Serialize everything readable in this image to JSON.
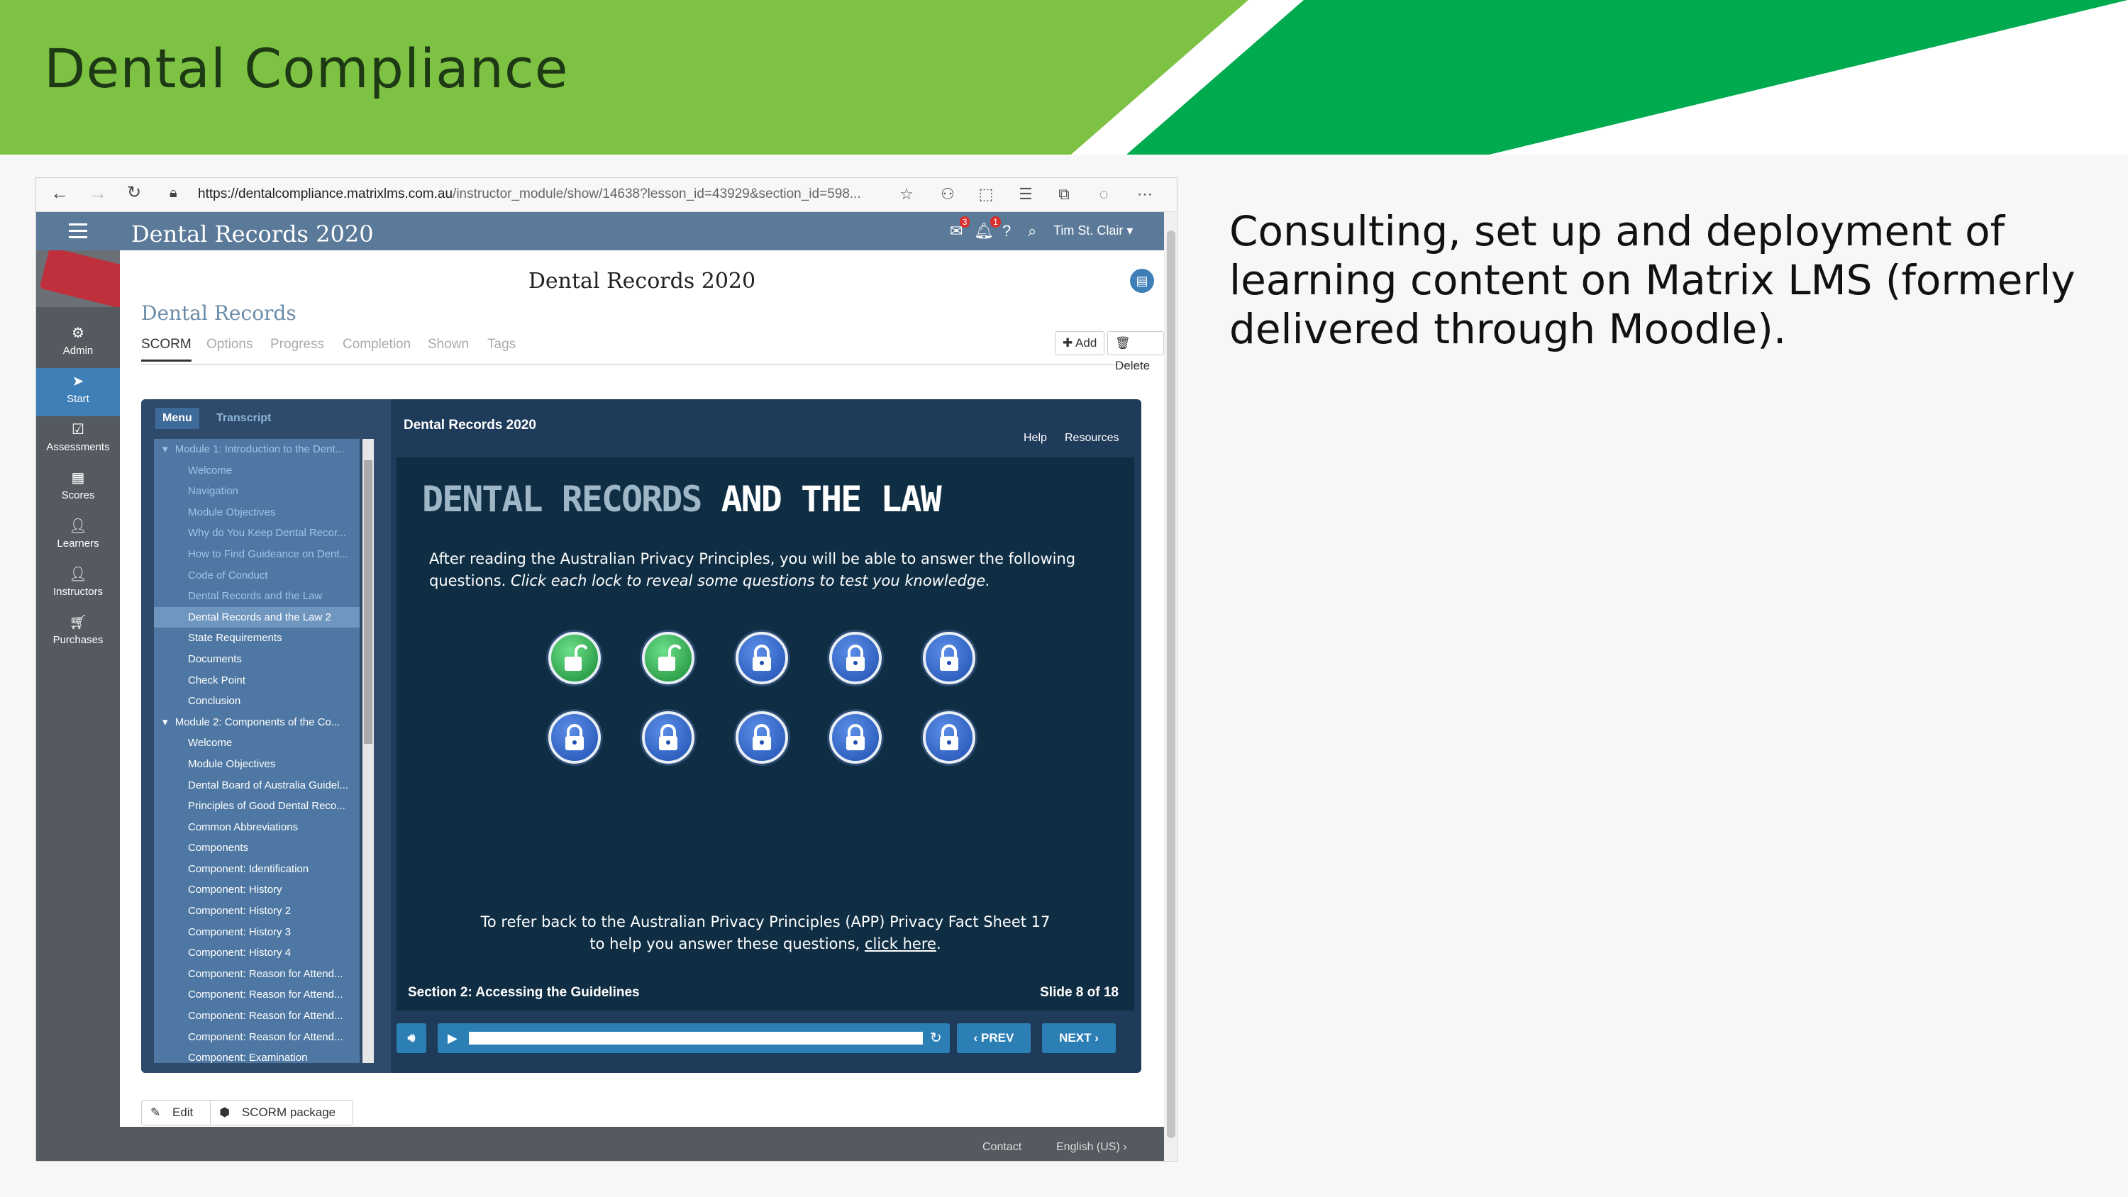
{
  "slide": {
    "title": "Dental Compliance",
    "description": "Consulting, set up and deployment of learning content on Matrix LMS (formerly delivered through Moodle).",
    "colors": {
      "light_green": "#7dc242",
      "dark_green": "#00aa4f"
    }
  },
  "browser": {
    "url_host": "https://dentalcompliance.matrixlms.com.au",
    "url_path": "/instructor_module/show/14638?lesson_id=43929&section_id=598..."
  },
  "app": {
    "title": "Dental Records 2020",
    "notifications_count": "3",
    "alerts_count": "1",
    "user": "Tim St. Clair"
  },
  "sidebar": {
    "items": [
      {
        "label": "Admin",
        "icon": "gear-icon"
      },
      {
        "label": "Start",
        "icon": "send-icon"
      },
      {
        "label": "Assessments",
        "icon": "checkbox-icon"
      },
      {
        "label": "Scores",
        "icon": "grid-icon"
      },
      {
        "label": "Learners",
        "icon": "user-icon"
      },
      {
        "label": "Instructors",
        "icon": "user-icon"
      },
      {
        "label": "Purchases",
        "icon": "cart-icon"
      }
    ]
  },
  "page": {
    "heading": "Dental Records 2020",
    "section": "Dental Records",
    "tabs": [
      "SCORM",
      "Options",
      "Progress",
      "Completion",
      "Shown",
      "Tags"
    ],
    "add_label": "Add",
    "delete_label": "Delete",
    "edit_label": "Edit",
    "package_label": "SCORM package",
    "footer_contact": "Contact",
    "footer_language": "English (US)"
  },
  "player": {
    "menu_tab": "Menu",
    "transcript_tab": "Transcript",
    "title": "Dental Records 2020",
    "help": "Help",
    "resources": "Resources",
    "menu_items": [
      {
        "label": "Module 1: Introduction to the Dent...",
        "kind": "module-dim"
      },
      {
        "label": "Welcome",
        "kind": "dim"
      },
      {
        "label": "Navigation",
        "kind": "dim"
      },
      {
        "label": "Module Objectives",
        "kind": "dim"
      },
      {
        "label": "Why do You Keep Dental Recor...",
        "kind": "dim"
      },
      {
        "label": "How to Find Guideance on Dent...",
        "kind": "dim"
      },
      {
        "label": "Code of Conduct",
        "kind": "dim"
      },
      {
        "label": "Dental Records and the Law",
        "kind": "dim"
      },
      {
        "label": "Dental Records and the Law 2",
        "kind": "current"
      },
      {
        "label": "State Requirements",
        "kind": "normal"
      },
      {
        "label": "Documents",
        "kind": "normal"
      },
      {
        "label": "Check Point",
        "kind": "normal"
      },
      {
        "label": "Conclusion",
        "kind": "normal"
      },
      {
        "label": "Module 2: Components of the Co...",
        "kind": "module"
      },
      {
        "label": "Welcome",
        "kind": "normal"
      },
      {
        "label": "Module Objectives",
        "kind": "normal"
      },
      {
        "label": "Dental Board of Australia Guidel...",
        "kind": "normal"
      },
      {
        "label": "Principles of Good Dental Reco...",
        "kind": "normal"
      },
      {
        "label": "Common Abbreviations",
        "kind": "normal"
      },
      {
        "label": "Components",
        "kind": "normal"
      },
      {
        "label": "Component: Identification",
        "kind": "normal"
      },
      {
        "label": "Component: History",
        "kind": "normal"
      },
      {
        "label": "Component: History 2",
        "kind": "normal"
      },
      {
        "label": "Component: History 3",
        "kind": "normal"
      },
      {
        "label": "Component: History 4",
        "kind": "normal"
      },
      {
        "label": "Component: Reason for Attend...",
        "kind": "normal"
      },
      {
        "label": "Component: Reason for Attend...",
        "kind": "normal"
      },
      {
        "label": "Component: Reason for Attend...",
        "kind": "normal"
      },
      {
        "label": "Component: Reason for Attend...",
        "kind": "normal"
      },
      {
        "label": "Component: Examination",
        "kind": "normal"
      }
    ],
    "slide_heading_part1": "DENTAL RECORDS",
    "slide_heading_part2": "AND THE LAW",
    "slide_intro": "After reading the Australian Privacy Principles, you will be able to answer the following questions.",
    "slide_intro_italic": "Click each lock to reveal some questions to test you knowledge.",
    "locks": [
      "open",
      "open",
      "closed",
      "closed",
      "closed",
      "closed",
      "closed",
      "closed",
      "closed",
      "closed"
    ],
    "slide_footer_line1": "To refer back to the Australian Privacy Principles (APP) Privacy Fact Sheet 17",
    "slide_footer_line2": "to help you answer these questions,",
    "slide_footer_link": "click here",
    "section_label": "Section 2: Accessing the Guidelines",
    "slide_counter": "Slide 8 of 18",
    "prev_label": "PREV",
    "next_label": "NEXT",
    "progress": 1.0
  }
}
